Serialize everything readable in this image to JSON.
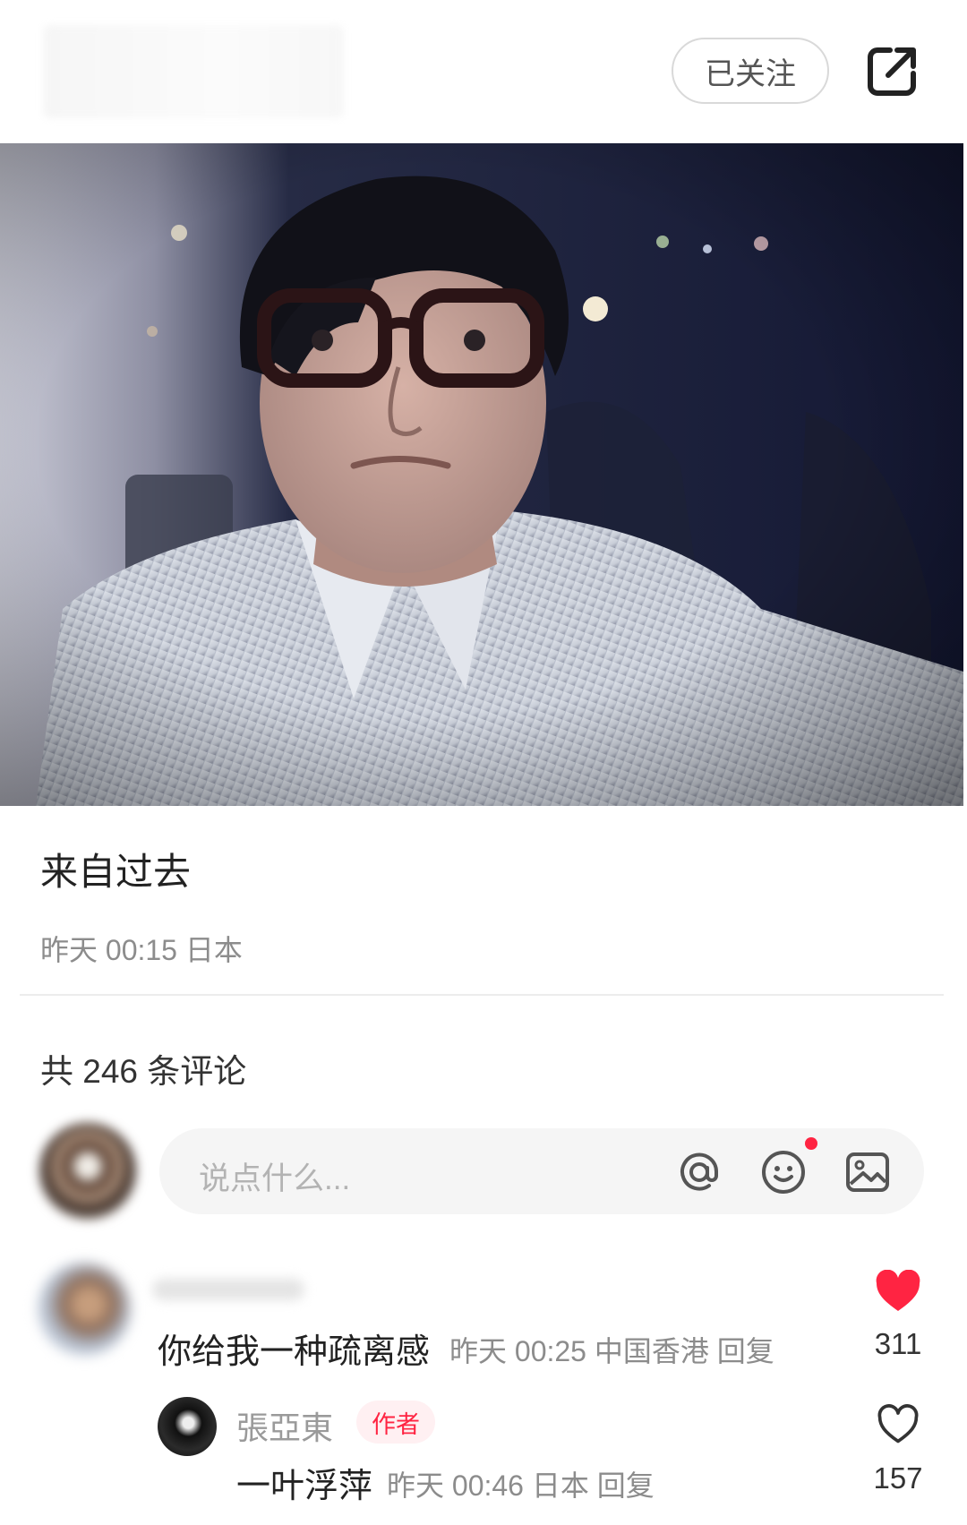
{
  "header": {
    "follow_label": "已关注",
    "icons": {
      "share": "share-external-icon"
    }
  },
  "post": {
    "photo": "selfie-photo",
    "title": "来自过去",
    "meta": "昨天 00:15 日本"
  },
  "comments_section": {
    "count_label": "共 246 条评论",
    "input": {
      "placeholder": "说点什么...",
      "icons": [
        "at-icon",
        "emoji-icon",
        "image-icon"
      ]
    },
    "items": [
      {
        "text": "你给我一种疏离感",
        "meta": "昨天 00:25 中国香港 回复",
        "likes": "311",
        "liked": true,
        "replies": [
          {
            "author": "張亞東",
            "badge": "作者",
            "text": "一叶浮萍",
            "meta": "昨天 00:46 日本 回复",
            "likes": "157",
            "liked": false
          }
        ]
      }
    ]
  },
  "colors": {
    "accent": "#ff2442",
    "meta_text": "#8c8c8c",
    "input_bg": "#f5f5f5"
  }
}
